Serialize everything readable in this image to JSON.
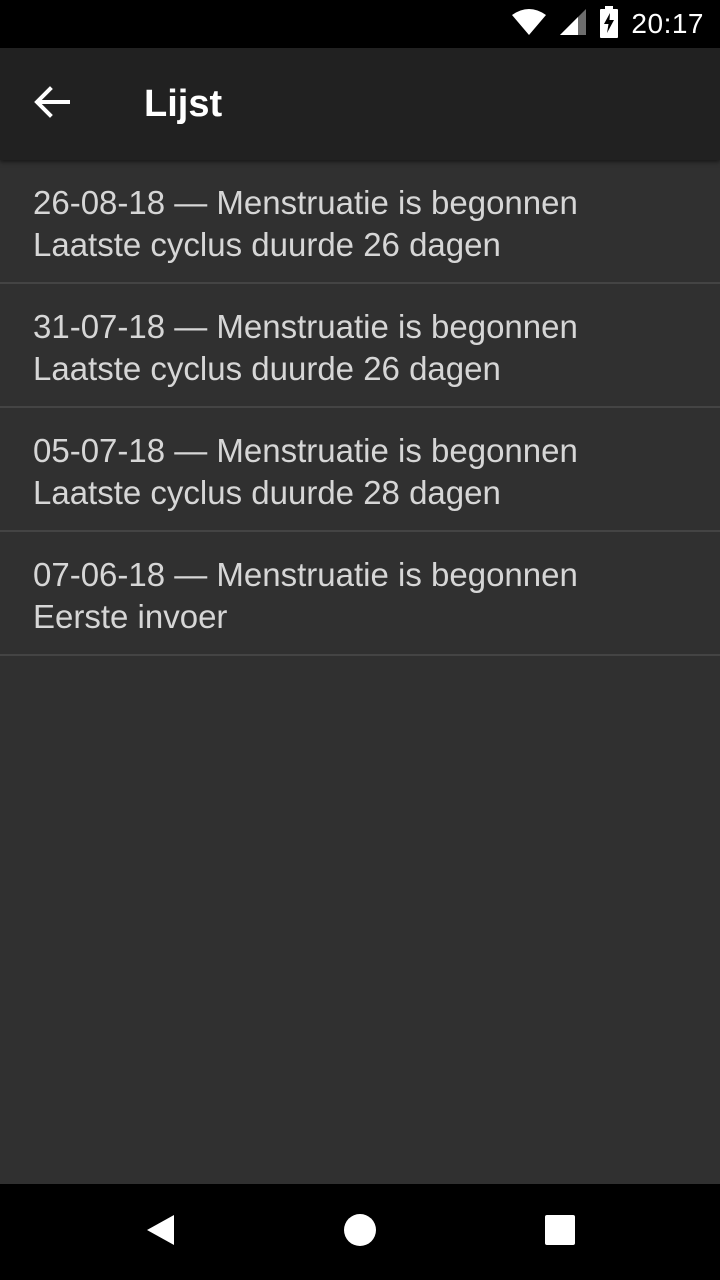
{
  "status_bar": {
    "time": "20:17"
  },
  "app_bar": {
    "title": "Lijst",
    "back_icon": "arrow-left-icon"
  },
  "list": {
    "items": [
      {
        "title": "26-08-18 — Menstruatie is begonnen",
        "subtitle": "Laatste cyclus duurde 26 dagen"
      },
      {
        "title": "31-07-18 — Menstruatie is begonnen",
        "subtitle": "Laatste cyclus duurde 26 dagen"
      },
      {
        "title": "05-07-18 — Menstruatie is begonnen",
        "subtitle": "Laatste cyclus duurde 28 dagen"
      },
      {
        "title": "07-06-18 — Menstruatie is begonnen",
        "subtitle": "Eerste invoer"
      }
    ]
  },
  "colors": {
    "background": "#303030",
    "app_bar": "#212121",
    "status_bar": "#000000",
    "text": "#d6d6d6",
    "divider": "#444444"
  }
}
